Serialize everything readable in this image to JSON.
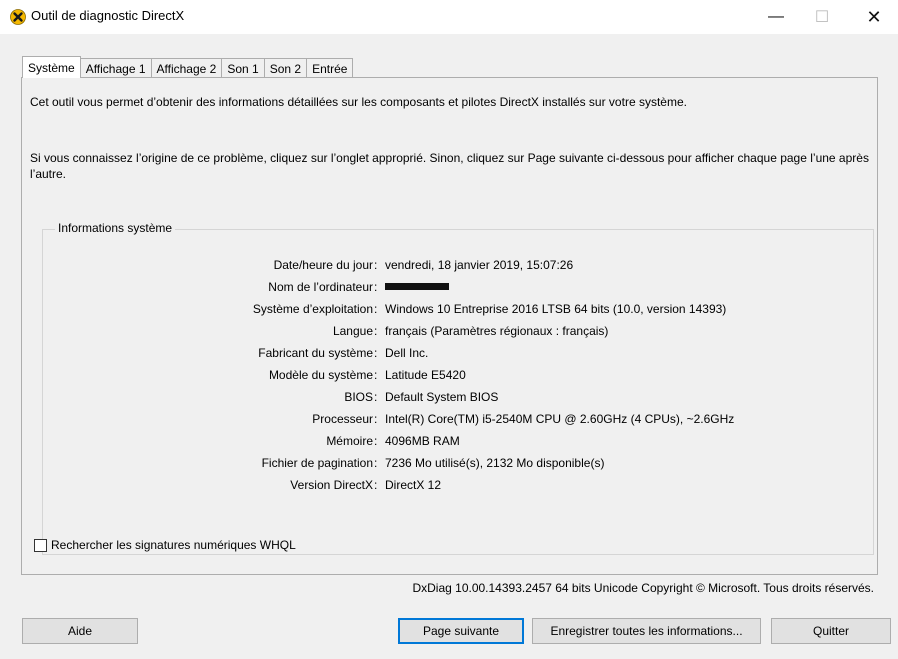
{
  "window": {
    "title": "Outil de diagnostic DirectX",
    "minimize": "—",
    "maximize": "☐",
    "close": "✕"
  },
  "tabs": [
    "Système",
    "Affichage 1",
    "Affichage 2",
    "Son 1",
    "Son 2",
    "Entrée"
  ],
  "active_tab": "Système",
  "intro": {
    "line1": "Cet outil vous permet d’obtenir des informations détaillées sur les composants et pilotes DirectX installés sur votre système.",
    "line2": "Si vous connaissez l’origine de ce problème, cliquez sur l’onglet approprié. Sinon, cliquez sur Page suivante ci-dessous pour afficher chaque page l’une après l’autre."
  },
  "system_info": {
    "group_title": "Informations système",
    "separator": ":",
    "rows": [
      {
        "label": "Date/heure du jour",
        "value": "vendredi, 18 janvier 2019, 15:07:26"
      },
      {
        "label": "Nom de l’ordinateur",
        "value": ""
      },
      {
        "label": "Système d’exploitation",
        "value": "Windows 10 Entreprise 2016 LTSB 64 bits (10.0, version 14393)"
      },
      {
        "label": "Langue",
        "value": "français (Paramètres régionaux : français)"
      },
      {
        "label": "Fabricant du système",
        "value": "Dell Inc."
      },
      {
        "label": "Modèle du système",
        "value": "Latitude E5420"
      },
      {
        "label": "BIOS",
        "value": "Default System BIOS"
      },
      {
        "label": "Processeur",
        "value": "Intel(R) Core(TM) i5-2540M CPU @ 2.60GHz (4 CPUs), ~2.6GHz"
      },
      {
        "label": "Mémoire",
        "value": "4096MB RAM"
      },
      {
        "label": "Fichier de pagination",
        "value": "7236 Mo utilisé(s), 2132 Mo disponible(s)"
      },
      {
        "label": "Version DirectX",
        "value": "DirectX 12"
      }
    ]
  },
  "whql_checkbox": {
    "label": "Rechercher les signatures numériques WHQL",
    "checked": false
  },
  "copyright": "DxDiag 10.00.14393.2457 64 bits Unicode Copyright © Microsoft. Tous droits réservés.",
  "buttons": {
    "help": "Aide",
    "next": "Page suivante",
    "save": "Enregistrer toutes les informations...",
    "quit": "Quitter"
  },
  "icons": {
    "app": "directx-icon"
  },
  "colors": {
    "accent": "#0078d7",
    "dialog_bg": "#f0f0f0",
    "icon_yellow": "#f5b800"
  }
}
